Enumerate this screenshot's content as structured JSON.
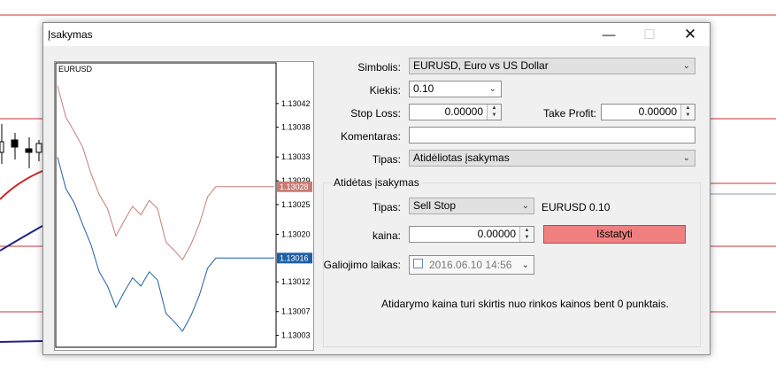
{
  "dialog": {
    "title": "Įsakymas",
    "minimize_icon": "minimize-icon",
    "maximize_icon": "maximize-icon",
    "close_icon": "close-icon"
  },
  "chart": {
    "symbol": "EURUSD",
    "bid_color": "#1f5fa8",
    "ask_color": "#c87c74",
    "ask_label": "1.13028",
    "bid_label": "1.13016",
    "ticks": [
      "1.13042",
      "1.13038",
      "1.13033",
      "1.13029",
      "1.13025",
      "1.13020",
      "1.13012",
      "1.13007",
      "1.13003"
    ]
  },
  "chart_data": {
    "type": "line",
    "title": "EURUSD",
    "ylim": [
      1.13001,
      1.13046
    ],
    "series": [
      {
        "color": "#c87c74",
        "values": [
          1.13045,
          1.1304,
          1.13037,
          1.13035,
          1.1303,
          1.13027,
          1.13024,
          1.1302,
          1.13022,
          1.13025,
          1.13023,
          1.13026,
          1.13024,
          1.13019,
          1.13017,
          1.13016,
          1.13018,
          1.13022,
          1.13026,
          1.13028,
          1.13028,
          1.13028,
          1.13028,
          1.13028,
          1.13028,
          1.13028,
          1.13028
        ]
      },
      {
        "color": "#1f5fa8",
        "values": [
          1.13033,
          1.13028,
          1.13025,
          1.13022,
          1.13018,
          1.13014,
          1.13011,
          1.13008,
          1.1301,
          1.13013,
          1.13011,
          1.13014,
          1.13012,
          1.13007,
          1.13005,
          1.13004,
          1.13006,
          1.1301,
          1.13014,
          1.13016,
          1.13016,
          1.13016,
          1.13016,
          1.13016,
          1.13016,
          1.13016,
          1.13016
        ]
      }
    ]
  },
  "form": {
    "symbol_label": "Simbolis:",
    "symbol_value": "EURUSD, Euro vs US Dollar",
    "volume_label": "Kiekis:",
    "volume_value": "0.10",
    "sl_label": "Stop Loss:",
    "sl_value": "0.00000",
    "tp_label": "Take Profit:",
    "tp_value": "0.00000",
    "comment_label": "Komentaras:",
    "comment_value": "",
    "type_label": "Tipas:",
    "type_value": "Atidėliotas įsakymas"
  },
  "pending": {
    "group_title": "Atidėtas įsakymas",
    "type_label": "Tipas:",
    "type_value": "Sell Stop",
    "summary": "EURUSD 0.10",
    "price_label": "kaina:",
    "price_value": "0.00000",
    "place_button": "Išstatyti",
    "place_color": "#f08080",
    "expiry_label": "Galiojimo laikas:",
    "expiry_value": "2016.06.10 14:56",
    "note": "Atidarymo kaina turi skirtis nuo rinkos kainos bent 0 punktais."
  }
}
